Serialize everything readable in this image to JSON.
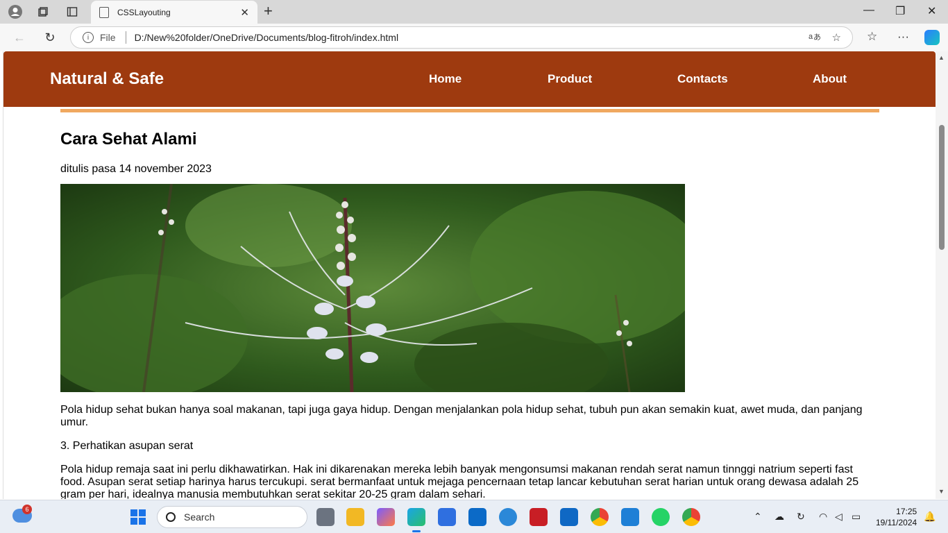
{
  "browser": {
    "tab_title": "CSSLayouting",
    "address_label": "File",
    "url": "D:/New%20folder/OneDrive/Documents/blog-fitroh/index.html"
  },
  "site": {
    "brand": "Natural & Safe",
    "nav": [
      "Home",
      "Product",
      "Contacts",
      "About"
    ]
  },
  "article": {
    "title": "Cara Sehat Alami",
    "date": "ditulis pasa 14 november 2023",
    "image_alt": "flower plant photo",
    "p1": "Pola hidup sehat bukan hanya soal makanan, tapi juga gaya hidup. Dengan menjalankan pola hidup sehat, tubuh pun akan semakin kuat, awet muda, dan panjang umur.",
    "p2": "3. Perhatikan asupan serat",
    "p3": "Pola hidup remaja saat ini perlu dikhawatirkan. Hak ini dikarenakan mereka lebih banyak mengonsumsi makanan rendah serat namun tinnggi natrium seperti fast food. Asupan serat setiap harinya harus tercukupi. serat bermanfaat untuk mejaga pencernaan tetap lancar kebutuhan serat harian untuk orang dewasa adalah 25 gram per hari, idealnya manusia membutuhkan serat sekitar 20-25 gram dalam sehari."
  },
  "taskbar": {
    "weather_badge": "6",
    "search_placeholder": "Search",
    "time": "17:25",
    "date": "19/11/2024"
  },
  "colors": {
    "header_bg": "#9e3a0f",
    "accent_border": "#f0a860"
  }
}
